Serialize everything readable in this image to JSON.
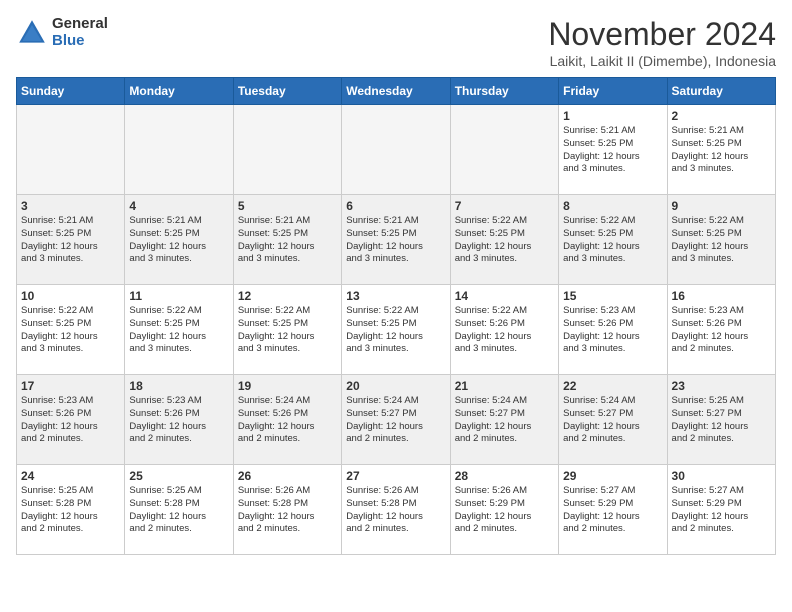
{
  "logo": {
    "general": "General",
    "blue": "Blue"
  },
  "title": {
    "month": "November 2024",
    "location": "Laikit, Laikit II (Dimembe), Indonesia"
  },
  "days_of_week": [
    "Sunday",
    "Monday",
    "Tuesday",
    "Wednesday",
    "Thursday",
    "Friday",
    "Saturday"
  ],
  "weeks": [
    {
      "shaded": false,
      "days": [
        {
          "date": "",
          "info": ""
        },
        {
          "date": "",
          "info": ""
        },
        {
          "date": "",
          "info": ""
        },
        {
          "date": "",
          "info": ""
        },
        {
          "date": "",
          "info": ""
        },
        {
          "date": "1",
          "info": "Sunrise: 5:21 AM\nSunset: 5:25 PM\nDaylight: 12 hours\nand 3 minutes."
        },
        {
          "date": "2",
          "info": "Sunrise: 5:21 AM\nSunset: 5:25 PM\nDaylight: 12 hours\nand 3 minutes."
        }
      ]
    },
    {
      "shaded": true,
      "days": [
        {
          "date": "3",
          "info": "Sunrise: 5:21 AM\nSunset: 5:25 PM\nDaylight: 12 hours\nand 3 minutes."
        },
        {
          "date": "4",
          "info": "Sunrise: 5:21 AM\nSunset: 5:25 PM\nDaylight: 12 hours\nand 3 minutes."
        },
        {
          "date": "5",
          "info": "Sunrise: 5:21 AM\nSunset: 5:25 PM\nDaylight: 12 hours\nand 3 minutes."
        },
        {
          "date": "6",
          "info": "Sunrise: 5:21 AM\nSunset: 5:25 PM\nDaylight: 12 hours\nand 3 minutes."
        },
        {
          "date": "7",
          "info": "Sunrise: 5:22 AM\nSunset: 5:25 PM\nDaylight: 12 hours\nand 3 minutes."
        },
        {
          "date": "8",
          "info": "Sunrise: 5:22 AM\nSunset: 5:25 PM\nDaylight: 12 hours\nand 3 minutes."
        },
        {
          "date": "9",
          "info": "Sunrise: 5:22 AM\nSunset: 5:25 PM\nDaylight: 12 hours\nand 3 minutes."
        }
      ]
    },
    {
      "shaded": false,
      "days": [
        {
          "date": "10",
          "info": "Sunrise: 5:22 AM\nSunset: 5:25 PM\nDaylight: 12 hours\nand 3 minutes."
        },
        {
          "date": "11",
          "info": "Sunrise: 5:22 AM\nSunset: 5:25 PM\nDaylight: 12 hours\nand 3 minutes."
        },
        {
          "date": "12",
          "info": "Sunrise: 5:22 AM\nSunset: 5:25 PM\nDaylight: 12 hours\nand 3 minutes."
        },
        {
          "date": "13",
          "info": "Sunrise: 5:22 AM\nSunset: 5:25 PM\nDaylight: 12 hours\nand 3 minutes."
        },
        {
          "date": "14",
          "info": "Sunrise: 5:22 AM\nSunset: 5:26 PM\nDaylight: 12 hours\nand 3 minutes."
        },
        {
          "date": "15",
          "info": "Sunrise: 5:23 AM\nSunset: 5:26 PM\nDaylight: 12 hours\nand 3 minutes."
        },
        {
          "date": "16",
          "info": "Sunrise: 5:23 AM\nSunset: 5:26 PM\nDaylight: 12 hours\nand 2 minutes."
        }
      ]
    },
    {
      "shaded": true,
      "days": [
        {
          "date": "17",
          "info": "Sunrise: 5:23 AM\nSunset: 5:26 PM\nDaylight: 12 hours\nand 2 minutes."
        },
        {
          "date": "18",
          "info": "Sunrise: 5:23 AM\nSunset: 5:26 PM\nDaylight: 12 hours\nand 2 minutes."
        },
        {
          "date": "19",
          "info": "Sunrise: 5:24 AM\nSunset: 5:26 PM\nDaylight: 12 hours\nand 2 minutes."
        },
        {
          "date": "20",
          "info": "Sunrise: 5:24 AM\nSunset: 5:27 PM\nDaylight: 12 hours\nand 2 minutes."
        },
        {
          "date": "21",
          "info": "Sunrise: 5:24 AM\nSunset: 5:27 PM\nDaylight: 12 hours\nand 2 minutes."
        },
        {
          "date": "22",
          "info": "Sunrise: 5:24 AM\nSunset: 5:27 PM\nDaylight: 12 hours\nand 2 minutes."
        },
        {
          "date": "23",
          "info": "Sunrise: 5:25 AM\nSunset: 5:27 PM\nDaylight: 12 hours\nand 2 minutes."
        }
      ]
    },
    {
      "shaded": false,
      "days": [
        {
          "date": "24",
          "info": "Sunrise: 5:25 AM\nSunset: 5:28 PM\nDaylight: 12 hours\nand 2 minutes."
        },
        {
          "date": "25",
          "info": "Sunrise: 5:25 AM\nSunset: 5:28 PM\nDaylight: 12 hours\nand 2 minutes."
        },
        {
          "date": "26",
          "info": "Sunrise: 5:26 AM\nSunset: 5:28 PM\nDaylight: 12 hours\nand 2 minutes."
        },
        {
          "date": "27",
          "info": "Sunrise: 5:26 AM\nSunset: 5:28 PM\nDaylight: 12 hours\nand 2 minutes."
        },
        {
          "date": "28",
          "info": "Sunrise: 5:26 AM\nSunset: 5:29 PM\nDaylight: 12 hours\nand 2 minutes."
        },
        {
          "date": "29",
          "info": "Sunrise: 5:27 AM\nSunset: 5:29 PM\nDaylight: 12 hours\nand 2 minutes."
        },
        {
          "date": "30",
          "info": "Sunrise: 5:27 AM\nSunset: 5:29 PM\nDaylight: 12 hours\nand 2 minutes."
        }
      ]
    }
  ]
}
